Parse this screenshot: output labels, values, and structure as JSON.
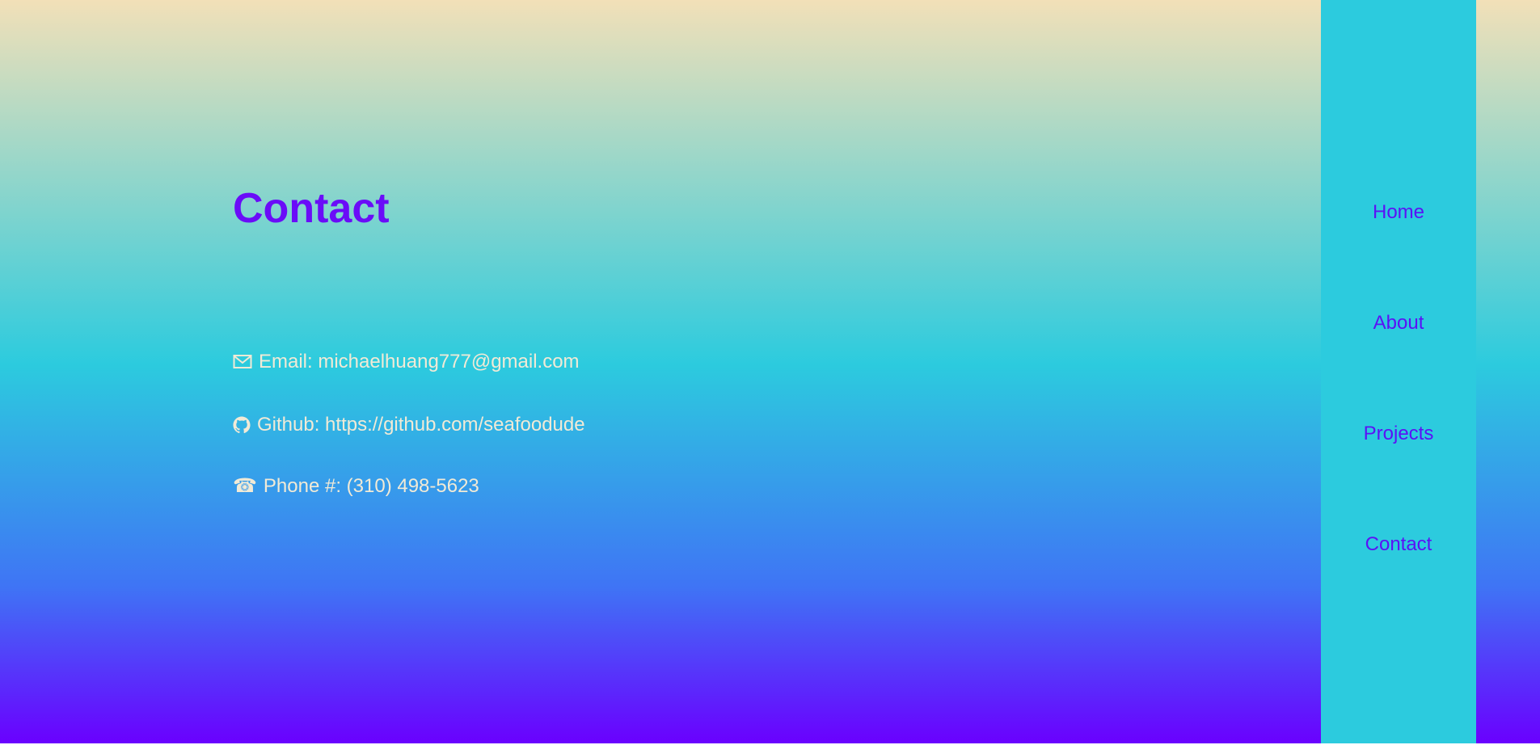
{
  "page": {
    "title": "Contact"
  },
  "contacts": {
    "email": {
      "icon": "envelope-icon",
      "text": "Email: michaelhuang777@gmail.com"
    },
    "github": {
      "icon": "github-icon",
      "text": "Github: https://github.com/seafoodude"
    },
    "phone": {
      "icon": "phone-icon",
      "glyph": "☎",
      "text": "Phone #: (310) 498-5623"
    }
  },
  "nav": {
    "items": [
      {
        "label": "Home"
      },
      {
        "label": "About"
      },
      {
        "label": "Projects"
      },
      {
        "label": "Contact"
      }
    ]
  },
  "colors": {
    "title": "#6a0cf8",
    "contact_text": "#f1ead6",
    "sidebar_bg": "#2ccbde",
    "nav_text": "#5b12f5",
    "gradient": [
      "#f2e0b8",
      "#2ccbde",
      "#3f74f5",
      "#6a00ff"
    ]
  }
}
